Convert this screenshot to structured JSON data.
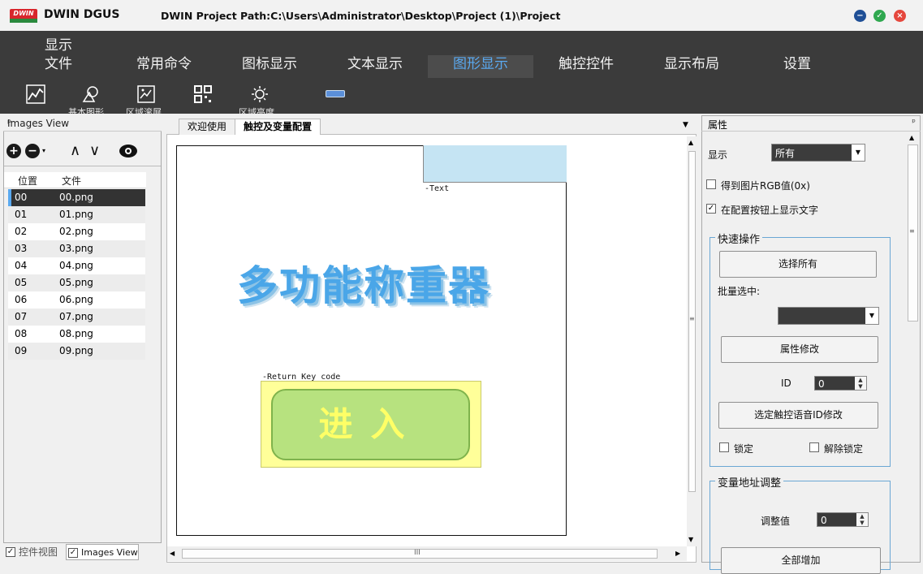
{
  "window": {
    "logo_text": "DWIN",
    "app_name": "DWIN DGUS",
    "project_path": "DWIN Project Path:C:\\Users\\Administrator\\Desktop\\Project (1)\\Project"
  },
  "menu": {
    "overflow_label": "显示",
    "items": [
      "文件",
      "常用命令",
      "图标显示",
      "文本显示",
      "图形显示",
      "触控控件",
      "显示布局",
      "设置"
    ],
    "active": "图形显示"
  },
  "toolbar": {
    "labels": [
      "基本图形",
      "区域滚屏",
      "区域亮度"
    ]
  },
  "left_panel": {
    "title": "Images View",
    "columns": [
      "位置",
      "文件"
    ],
    "rows": [
      {
        "pos": "00",
        "file": "00.png"
      },
      {
        "pos": "01",
        "file": "01.png"
      },
      {
        "pos": "02",
        "file": "02.png"
      },
      {
        "pos": "03",
        "file": "03.png"
      },
      {
        "pos": "04",
        "file": "04.png"
      },
      {
        "pos": "05",
        "file": "05.png"
      },
      {
        "pos": "06",
        "file": "06.png"
      },
      {
        "pos": "07",
        "file": "07.png"
      },
      {
        "pos": "08",
        "file": "08.png"
      },
      {
        "pos": "09",
        "file": "09.png"
      }
    ],
    "bottom_tabs": [
      "控件视图",
      "Images View"
    ]
  },
  "center": {
    "tabs": [
      "欢迎使用",
      "触控及变量配置"
    ],
    "active_tab": "触控及变量配置",
    "text_label": "-Text",
    "return_label": "-Return Key code",
    "title_text": "多功能称重器",
    "enter_button": "进入",
    "scroll_mid": "III"
  },
  "properties": {
    "title": "属性",
    "display_label": "显示",
    "display_value": "所有",
    "rgb_checkbox": "得到图片RGB值(0x)",
    "rgb_checked": false,
    "show_text_checkbox": "在配置按钮上显示文字",
    "show_text_checked": true,
    "quick_group": "快速操作",
    "select_all": "选择所有",
    "batch_label": "批量选中:",
    "batch_value": "",
    "modify_attr": "属性修改",
    "id_label": "ID",
    "id_value": "0",
    "voice_id_btn": "选定触控语音ID修改",
    "lock_label": "锁定",
    "unlock_label": "解除锁定",
    "addr_group": "变量地址调整",
    "adjust_label": "调整值",
    "adjust_value": "0",
    "increase_btn": "全部增加"
  },
  "colors": {
    "menubar": "#3b3b3b",
    "active_menu": "#5aa9f0",
    "title_blue": "#4aa6e8",
    "button_green": "#b7e27f",
    "button_text": "#ffff66",
    "yellow_bg": "#ffff99",
    "light_blue": "#c5e4f3"
  }
}
